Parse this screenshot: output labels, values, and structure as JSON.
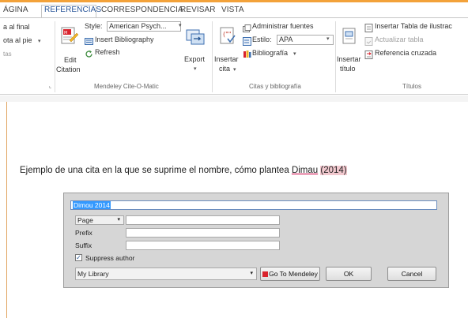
{
  "tabs": [
    {
      "label": "ÁGINA"
    },
    {
      "label": "REFERENCIAS"
    },
    {
      "label": "CORRESPONDENCIA"
    },
    {
      "label": "REVISAR"
    },
    {
      "label": "VISTA"
    }
  ],
  "ribbon": {
    "footnotes": {
      "line1": "a al final",
      "line2": "ota al pie",
      "line3": "tas"
    },
    "mendeley": {
      "edit_citation_line1": "Edit",
      "edit_citation_line2": "Citation",
      "style_label": "Style:",
      "style_value": "American Psych...",
      "insert_bibliography": "Insert Bibliography",
      "refresh": "Refresh",
      "export": "Export",
      "group_label": "Mendeley Cite-O-Matic"
    },
    "citas": {
      "insertar_cita_line1": "Insertar",
      "insertar_cita_line2": "cita",
      "administrar_fuentes": "Administrar fuentes",
      "estilo_label": "Estilo:",
      "estilo_value": "APA",
      "bibliografia": "Bibliografía",
      "group_label": "Citas y bibliografía"
    },
    "titulos": {
      "insertar_titulo_line1": "Insertar",
      "insertar_titulo_line2": "título",
      "insertar_tabla": "Insertar Tabla de ilustrac",
      "actualizar_tabla": "Actualizar tabla",
      "referencia_cruzada": "Referencia cruzada",
      "group_label": "Títulos"
    }
  },
  "document": {
    "sentence_prefix": "Ejemplo de una cita en la que se suprime el nombre, cómo plantea",
    "sentence_author": "Dimau",
    "sentence_year": "(2014)"
  },
  "dialog": {
    "citation_text": "Dimou 2014",
    "locator_type": "Page",
    "prefix_label": "Prefix",
    "suffix_label": "Suffix",
    "suppress_author_label": "Suppress author",
    "suppress_author_checked": true,
    "library": "My Library",
    "go_to_mendeley": "Go To Mendeley",
    "ok": "OK",
    "cancel": "Cancel"
  },
  "colors": {
    "accent_orange": "#f3a23a",
    "active_tab_blue": "#2b579a",
    "mendeley_red": "#d9232d"
  }
}
